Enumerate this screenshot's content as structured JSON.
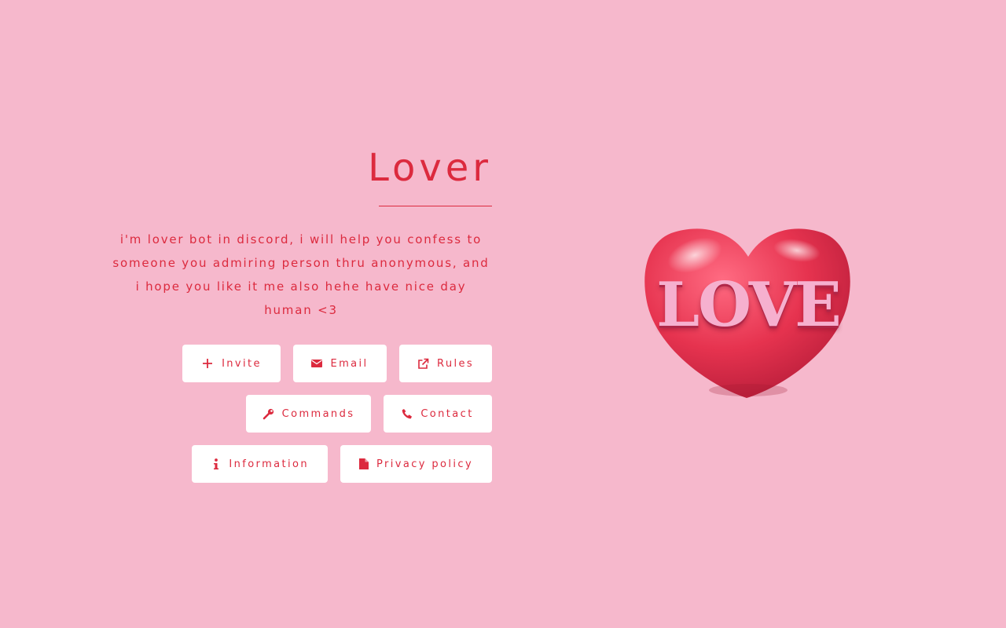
{
  "page": {
    "title": "Lover",
    "description": "i'm lover bot in discord, i will help you confess to someone you admiring person thru anonymous, and i hope you like it me also hehe have nice day human <3"
  },
  "buttons": {
    "invite": {
      "label": "Invite",
      "icon": "plus-icon"
    },
    "email": {
      "label": "Email",
      "icon": "envelope-icon"
    },
    "rules": {
      "label": "Rules",
      "icon": "external-link-icon"
    },
    "commands": {
      "label": "Commands",
      "icon": "wrench-icon"
    },
    "contact": {
      "label": "Contact",
      "icon": "phone-icon"
    },
    "information": {
      "label": "Information",
      "icon": "info-icon"
    },
    "privacy": {
      "label": "Privacy policy",
      "icon": "file-icon"
    }
  },
  "hero_image": {
    "text": "LOVE",
    "icon": "heart-icon"
  },
  "colors": {
    "background": "#f6b8cc",
    "accent": "#dc2a3e",
    "button_bg": "#ffffff",
    "heart": "#e63a55"
  }
}
